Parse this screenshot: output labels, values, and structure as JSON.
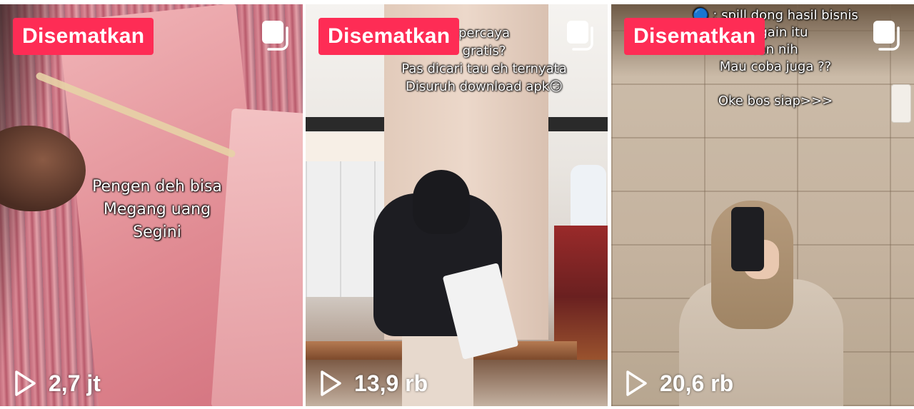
{
  "videos": [
    {
      "badge": "Disematkan",
      "caption": "Pengen deh bisa\nMegang uang\nSegini",
      "views": "2,7 jt"
    },
    {
      "badge": "Disematkan",
      "caption": "percaya\ngratis?\nPas dicari tau eh ternyata\nDisuruh download apk😏",
      "views": "13,9 rb"
    },
    {
      "badge": "Disematkan",
      "caption": "🔵 : spill dong hasil bisnis\nnggain itu\nran nih\nMau coba juga ??\n\nOke bos siap>>>",
      "views": "20,6 rb"
    }
  ],
  "icons": {
    "multi": "multi-photo-icon",
    "play": "play-icon"
  },
  "colors": {
    "badge": "#fe2c55",
    "text": "#ffffff"
  }
}
